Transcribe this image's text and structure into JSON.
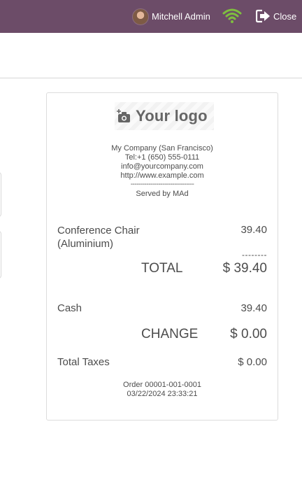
{
  "header": {
    "user_name": "Mitchell Admin",
    "close_label": "Close",
    "wifi_color": "#7fbf3f",
    "bar_color": "#6c4c68"
  },
  "receipt": {
    "logo_text": "Your logo",
    "company_lines": [
      "My Company (San Francisco)",
      "Tel:+1 (650) 555-0111",
      "info@yourcompany.com",
      "http://www.example.com"
    ],
    "separator": "--------------------------------",
    "served_by": "Served by MAd",
    "lines": [
      {
        "product_line1": "Conference Chair",
        "product_line2": "(Aluminium)",
        "price": "39.40"
      }
    ],
    "total_separator": "--------",
    "total_label": "TOTAL",
    "total_value": "$ 39.40",
    "payment_method": "Cash",
    "payment_amount": "39.40",
    "change_label": "CHANGE",
    "change_value": "$ 0.00",
    "taxes_label": "Total Taxes",
    "taxes_value": "$ 0.00",
    "order_ref": "Order 00001-001-0001",
    "order_datetime": "03/22/2024 23:33:21"
  }
}
